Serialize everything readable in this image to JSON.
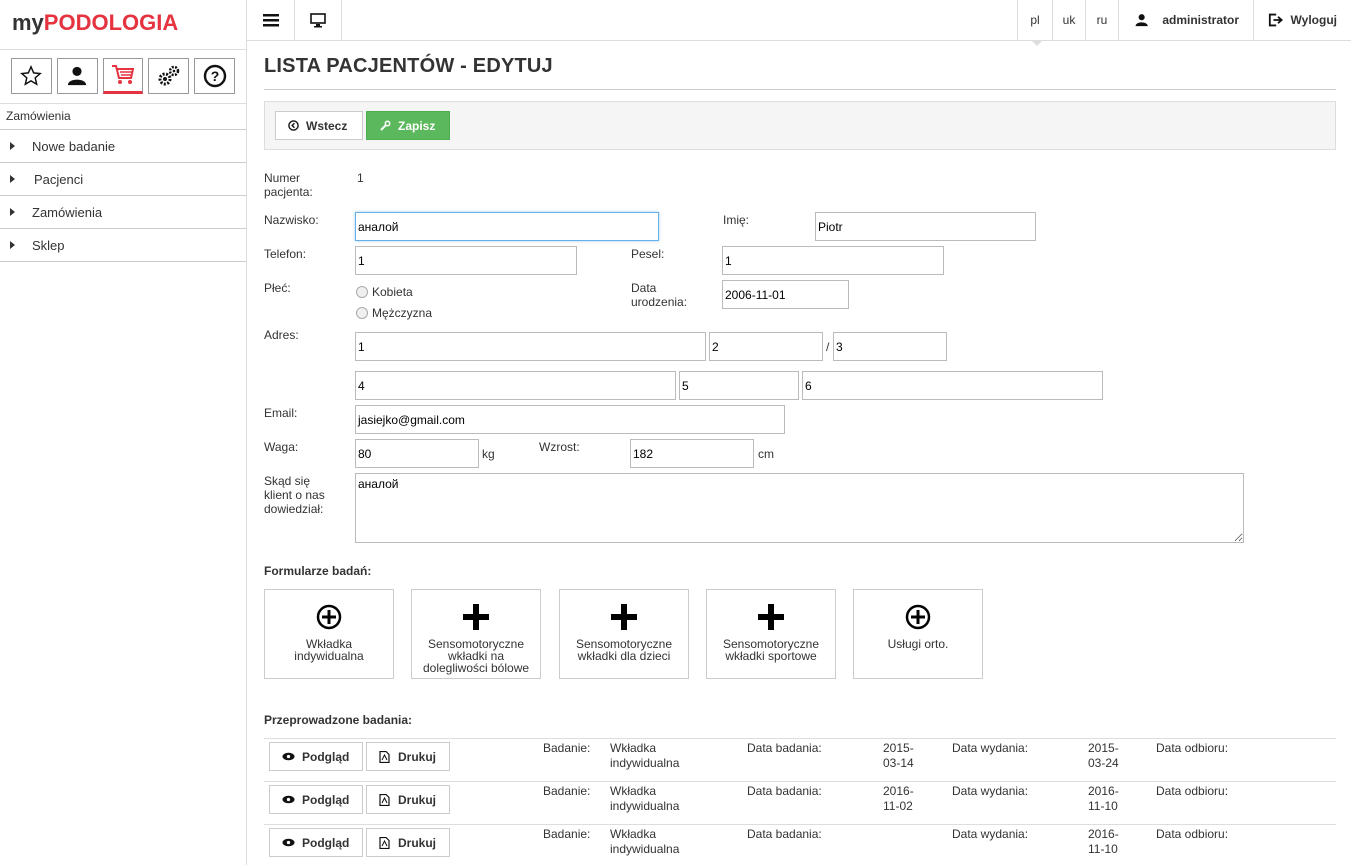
{
  "brand": {
    "my": "my",
    "name": "PODOLOGIA"
  },
  "sidebar": {
    "section": "Zamówienia",
    "items": [
      {
        "label": "Nowe badanie"
      },
      {
        "label": "Pacjenci"
      },
      {
        "label": "Zamówienia"
      },
      {
        "label": "Sklep"
      }
    ]
  },
  "topbar": {
    "langs": [
      "pl",
      "uk",
      "ru"
    ],
    "user": "administrator",
    "logout": "Wyloguj"
  },
  "page": {
    "title": "LISTA PACJENTÓW - EDYTUJ",
    "back": "Wstecz",
    "save": "Zapisz"
  },
  "form": {
    "patient_no_label_1": "Numer",
    "patient_no_label_2": "pacjenta:",
    "patient_no": "1",
    "surname_label": "Nazwisko:",
    "surname": "аналой",
    "firstname_label": "Imię:",
    "firstname": "Piotr",
    "phone_label": "Telefon:",
    "phone": "1",
    "pesel_label": "Pesel:",
    "pesel": "1",
    "gender_label": "Płeć:",
    "gender_female": "Kobieta",
    "gender_male": "Mężczyzna",
    "dob_label_1": "Data",
    "dob_label_2": "urodzenia:",
    "dob": "2006-11-01",
    "address_label": "Adres:",
    "addr_street": "1",
    "addr_house": "2",
    "addr_sep": "/",
    "addr_flat": "3",
    "addr_zip": "4",
    "addr_city": "5",
    "addr_country": "6",
    "email_label": "Email:",
    "email": "jasiejko@gmail.com",
    "weight_label": "Waga:",
    "weight": "80",
    "weight_unit": "kg",
    "height_label": "Wzrost:",
    "height": "182",
    "height_unit": "cm",
    "source_label_1": "Skąd się",
    "source_label_2": "klient o nas",
    "source_label_3": "dowiedział:",
    "source": "аналой"
  },
  "forms_section": {
    "title": "Formularze badań:",
    "cards": [
      {
        "l1": "Wkładka",
        "l2": "indywidualna",
        "l3": ""
      },
      {
        "l1": "Sensomotoryczne",
        "l2": "wkładki na",
        "l3": "dolegliwości bólowe"
      },
      {
        "l1": "Sensomotoryczne",
        "l2": "wkładki dla dzieci",
        "l3": ""
      },
      {
        "l1": "Sensomotoryczne",
        "l2": "wkładki sportowe",
        "l3": ""
      },
      {
        "l1": "Usługi orto.",
        "l2": "",
        "l3": ""
      }
    ]
  },
  "exams": {
    "title": "Przeprowadzone badania:",
    "preview": "Podgląd",
    "print": "Drukuj",
    "lbl_exam": "Badanie:",
    "lbl_date": "Data badania:",
    "lbl_issue": "Data wydania:",
    "lbl_pickup": "Data odbioru:",
    "rows": [
      {
        "type1": "Wkładka",
        "type2": "indywidualna",
        "date1": "2015-",
        "date2": "03-14",
        "issue1": "2015-",
        "issue2": "03-24"
      },
      {
        "type1": "Wkładka",
        "type2": "indywidualna",
        "date1": "2016-",
        "date2": "11-02",
        "issue1": "2016-",
        "issue2": "11-10"
      },
      {
        "type1": "Wkładka",
        "type2": "indywidualna",
        "date1": "",
        "date2": "",
        "issue1": "2016-",
        "issue2": "11-10"
      }
    ]
  }
}
